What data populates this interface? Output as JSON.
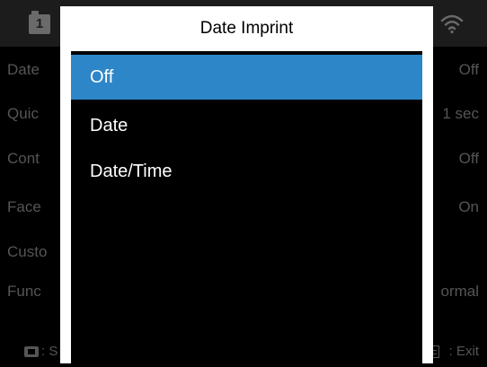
{
  "background_menu": {
    "tab_number": "1",
    "rows": [
      {
        "label": "Date",
        "value": "Off"
      },
      {
        "label": "Quic",
        "value": "1 sec"
      },
      {
        "label": "Cont",
        "value": "Off"
      },
      {
        "label": "Face",
        "value": "On"
      },
      {
        "label": "Custo",
        "value": ""
      },
      {
        "label": "Func",
        "value": "ormal"
      }
    ],
    "footer": {
      "left_text": ": S",
      "right_text": ": Exit"
    }
  },
  "dialog": {
    "title": "Date Imprint",
    "options": [
      {
        "label": "Off",
        "selected": true
      },
      {
        "label": "Date",
        "selected": false
      },
      {
        "label": "Date/Time",
        "selected": false
      }
    ]
  },
  "colors": {
    "selection": "#2d86c8",
    "dialog_header": "#ffffff",
    "background": "#000000"
  }
}
